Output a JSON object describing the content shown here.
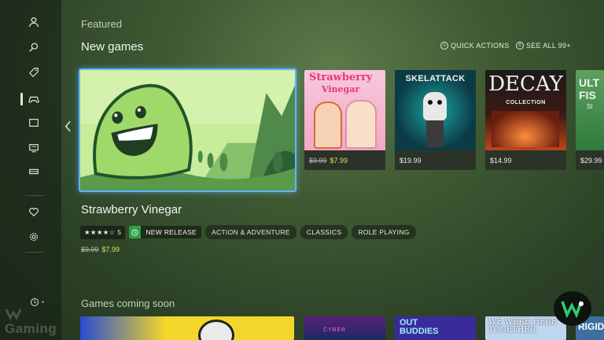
{
  "sidebar": {
    "items": [
      {
        "icon": "profile-icon"
      },
      {
        "icon": "search-icon"
      },
      {
        "icon": "tag-icon"
      },
      {
        "icon": "controller-icon",
        "active": true
      },
      {
        "icon": "tablet-icon"
      },
      {
        "icon": "monitor-icon"
      },
      {
        "icon": "card-icon"
      },
      {
        "icon": "heart-icon"
      },
      {
        "icon": "gear-icon"
      }
    ],
    "bottom_icon": "recent-icon",
    "bottom_badge": "•"
  },
  "watermark": "Gaming",
  "section": {
    "label": "Featured"
  },
  "new_games": {
    "title": "New games",
    "quick_actions": "QUICK ACTIONS",
    "see_all": "SEE ALL 99+"
  },
  "featured": {
    "title": "Strawberry Vinegar",
    "rating_stars": "★★★★☆",
    "rating_count": "5",
    "badge": "NEW RELEASE",
    "tags": [
      "ACTION & ADVENTURE",
      "CLASSICS",
      "ROLE PLAYING"
    ],
    "price_old": "$9.99",
    "price_new": "$7.99"
  },
  "cards": [
    {
      "name": "Strawberry Vinegar",
      "art_line1": "Strawberry",
      "art_line2": "Vinegar",
      "price_old": "$9.99",
      "price": "$7.99"
    },
    {
      "name": "Skelattack",
      "art_line1": "SKELATTACK",
      "price": "$19.99"
    },
    {
      "name": "Decay Collection",
      "art_line1": "DECAY",
      "art_line2": "COLLECTION",
      "price": "$14.99"
    },
    {
      "name": "Ultra Fishing Sim",
      "art_line1": "ULT",
      "art_line2": "FIS",
      "art_line3": "SI",
      "price": "$29.99"
    }
  ],
  "coming_soon": {
    "title": "Games coming soon",
    "tiles": [
      {
        "art": ""
      },
      {
        "art": "CYBER"
      },
      {
        "art": "OUT BUDDIES"
      },
      {
        "art": "WE WERE HERE TOGETHER"
      },
      {
        "art": "RIGID"
      }
    ]
  },
  "colors": {
    "focus": "#5fb4ff",
    "sale_price": "#d7e35a",
    "new_badge": "#2ea043"
  }
}
